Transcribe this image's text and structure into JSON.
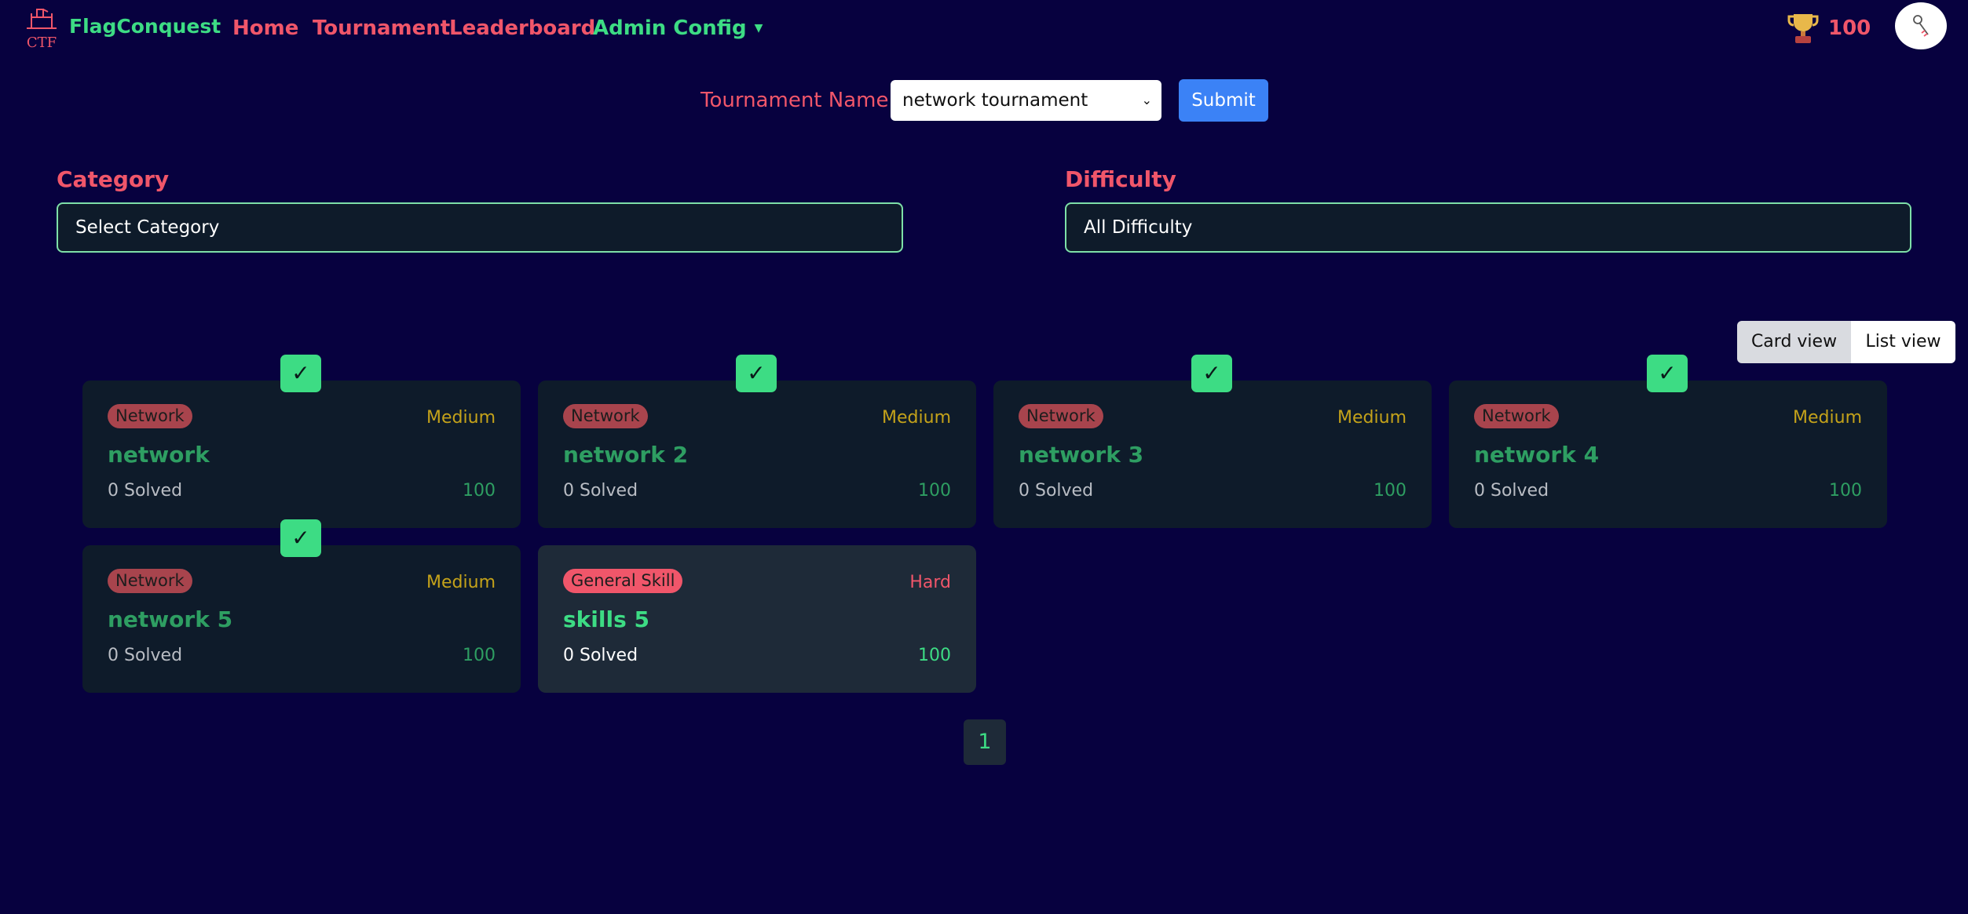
{
  "brand": {
    "name": "FlagConquest",
    "logo_text": "CTF"
  },
  "nav": {
    "items": [
      {
        "label": "Home"
      },
      {
        "label": "Tournament"
      },
      {
        "label": "Leaderboard"
      },
      {
        "label": "Admin Config"
      }
    ]
  },
  "user": {
    "score": "100"
  },
  "tournament": {
    "label": "Tournament Name:",
    "selected": "network tournament",
    "submit_label": "Submit"
  },
  "filters": {
    "category": {
      "label": "Category",
      "value": "Select Category"
    },
    "difficulty": {
      "label": "Difficulty",
      "value": "All Difficulty"
    }
  },
  "view_toggle": {
    "card": "Card view",
    "list": "List view",
    "active": "card"
  },
  "challenges": [
    {
      "category": "Network",
      "difficulty": "Medium",
      "title": "network",
      "solved": "0 Solved",
      "points": "100",
      "completed": true
    },
    {
      "category": "Network",
      "difficulty": "Medium",
      "title": "network 2",
      "solved": "0 Solved",
      "points": "100",
      "completed": true
    },
    {
      "category": "Network",
      "difficulty": "Medium",
      "title": "network 3",
      "solved": "0 Solved",
      "points": "100",
      "completed": true
    },
    {
      "category": "Network",
      "difficulty": "Medium",
      "title": "network 4",
      "solved": "0 Solved",
      "points": "100",
      "completed": true
    },
    {
      "category": "Network",
      "difficulty": "Medium",
      "title": "network 5",
      "solved": "0 Solved",
      "points": "100",
      "completed": true
    },
    {
      "category": "General Skill",
      "difficulty": "Hard",
      "title": "skills 5",
      "solved": "0 Solved",
      "points": "100",
      "completed": false
    }
  ],
  "check_glyph": "✓",
  "pagination": {
    "current": "1"
  },
  "colors": {
    "background": "#07013f",
    "accent_red": "#f0566a",
    "accent_green": "#3ddc84",
    "card_bg": "#0e1b2a",
    "button_blue": "#3b82f6"
  },
  "icons": {
    "logo": "castle-ctf-icon",
    "trophy": "trophy-icon",
    "avatar": "user-key-icon",
    "check": "check-icon"
  }
}
